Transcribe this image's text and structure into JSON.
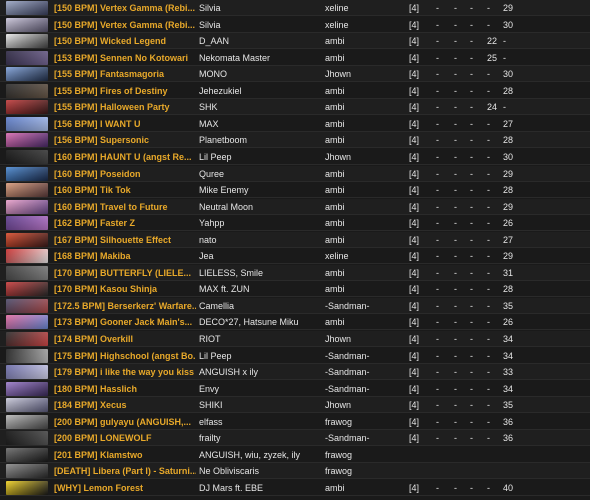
{
  "rows": [
    {
      "title": "[150 BPM] Vertex Gamma (Rebi...",
      "artist": "Silvia",
      "mapper": "xeline",
      "diffs": [
        "[4]",
        "-",
        "-",
        "-",
        "-",
        "29"
      ],
      "thumb_colors": [
        "#9aa6c4",
        "#3a3f5c"
      ]
    },
    {
      "title": "[150 BPM] Vertex Gamma (Rebi...",
      "artist": "Silvia",
      "mapper": "xeline",
      "diffs": [
        "[4]",
        "-",
        "-",
        "-",
        "-",
        "30"
      ],
      "thumb_colors": [
        "#c9c4d8",
        "#5a556e"
      ]
    },
    {
      "title": "[150 BPM] Wicked Legend",
      "artist": "D_AAN",
      "mapper": "ambi",
      "diffs": [
        "[4]",
        "-",
        "-",
        "-",
        "22",
        "-"
      ],
      "thumb_colors": [
        "#e8e8e8",
        "#444444"
      ]
    },
    {
      "title": "[153 BPM] Sennen No Kotowari",
      "artist": "Nekomata Master",
      "mapper": "ambi",
      "diffs": [
        "[4]",
        "-",
        "-",
        "-",
        "25",
        "-"
      ],
      "thumb_colors": [
        "#2b2640",
        "#7a6a9a"
      ]
    },
    {
      "title": "[155 BPM] Fantasmagoria",
      "artist": "MONO",
      "mapper": "Jhown",
      "diffs": [
        "[4]",
        "-",
        "-",
        "-",
        "-",
        "30"
      ],
      "thumb_colors": [
        "#7fa0d8",
        "#22304a"
      ]
    },
    {
      "title": "[155 BPM] Fires of Destiny",
      "artist": "Jehezukiel",
      "mapper": "ambi",
      "diffs": [
        "[4]",
        "-",
        "-",
        "-",
        "-",
        "28"
      ],
      "thumb_colors": [
        "#2a2a2a",
        "#6b5a4a"
      ]
    },
    {
      "title": "[155 BPM] Halloween Party",
      "artist": "SHK",
      "mapper": "ambi",
      "diffs": [
        "[4]",
        "-",
        "-",
        "-",
        "24",
        "-"
      ],
      "thumb_colors": [
        "#c03a3a",
        "#3a1a1a"
      ]
    },
    {
      "title": "[156 BPM] I WANT U",
      "artist": "MAX",
      "mapper": "ambi",
      "diffs": [
        "[4]",
        "-",
        "-",
        "-",
        "-",
        "27"
      ],
      "thumb_colors": [
        "#5a7ac8",
        "#b0c4f0"
      ]
    },
    {
      "title": "[156 BPM] Supersonic",
      "artist": "Planetboom",
      "mapper": "ambi",
      "diffs": [
        "[4]",
        "-",
        "-",
        "-",
        "-",
        "28"
      ],
      "thumb_colors": [
        "#d86ab0",
        "#4a2a6a"
      ]
    },
    {
      "title": "[160 BPM] HAUNT U (angst Re...",
      "artist": "Lil Peep",
      "mapper": "Jhown",
      "diffs": [
        "[4]",
        "-",
        "-",
        "-",
        "-",
        "30"
      ],
      "thumb_colors": [
        "#111111",
        "#444444"
      ]
    },
    {
      "title": "[160 BPM] Poseidon",
      "artist": "Quree",
      "mapper": "ambi",
      "diffs": [
        "[4]",
        "-",
        "-",
        "-",
        "-",
        "29"
      ],
      "thumb_colors": [
        "#4a88d0",
        "#1a2a4a"
      ]
    },
    {
      "title": "[160 BPM] Tik Tok",
      "artist": "Mike Enemy",
      "mapper": "ambi",
      "diffs": [
        "[4]",
        "-",
        "-",
        "-",
        "-",
        "28"
      ],
      "thumb_colors": [
        "#d89a7a",
        "#5a3a3a"
      ]
    },
    {
      "title": "[160 BPM] Travel to Future",
      "artist": "Neutral Moon",
      "mapper": "ambi",
      "diffs": [
        "[4]",
        "-",
        "-",
        "-",
        "-",
        "29"
      ],
      "thumb_colors": [
        "#e8a0c8",
        "#6a4a8a"
      ]
    },
    {
      "title": "[162 BPM] Faster Z",
      "artist": "Yahpp",
      "mapper": "ambi",
      "diffs": [
        "[4]",
        "-",
        "-",
        "-",
        "-",
        "26"
      ],
      "thumb_colors": [
        "#5a3a8a",
        "#c07ad0"
      ]
    },
    {
      "title": "[167 BPM] Silhouette Effect",
      "artist": "nato",
      "mapper": "ambi",
      "diffs": [
        "[4]",
        "-",
        "-",
        "-",
        "-",
        "27"
      ],
      "thumb_colors": [
        "#d84a2a",
        "#3a1a1a"
      ]
    },
    {
      "title": "[168 BPM] Makiba",
      "artist": "Jea",
      "mapper": "xeline",
      "diffs": [
        "[4]",
        "-",
        "-",
        "-",
        "-",
        "29"
      ],
      "thumb_colors": [
        "#c82a2a",
        "#f0f0f0"
      ]
    },
    {
      "title": "[170 BPM] BUTTERFLY (LIELE...",
      "artist": "LIELESS, Smile",
      "mapper": "ambi",
      "diffs": [
        "[4]",
        "-",
        "-",
        "-",
        "-",
        "31"
      ],
      "thumb_colors": [
        "#3a3a3a",
        "#8a8a8a"
      ]
    },
    {
      "title": "[170 BPM] Kasou Shinja",
      "artist": "MAX ft. ZUN",
      "mapper": "ambi",
      "diffs": [
        "[4]",
        "-",
        "-",
        "-",
        "-",
        "28"
      ],
      "thumb_colors": [
        "#c83a3a",
        "#2a2a2a"
      ]
    },
    {
      "title": "[172.5 BPM] Berserkerz' Warfare...",
      "artist": "Camellia",
      "mapper": "-Sandman-",
      "diffs": [
        "[4]",
        "-",
        "-",
        "-",
        "-",
        "35"
      ],
      "thumb_colors": [
        "#4a4a6a",
        "#b04a4a"
      ]
    },
    {
      "title": "[173 BPM] Gooner Jack Main's...",
      "artist": "DECO*27, Hatsune Miku",
      "mapper": "ambi",
      "diffs": [
        "[4]",
        "-",
        "-",
        "-",
        "-",
        "26"
      ],
      "thumb_colors": [
        "#e06aa0",
        "#6a8ad8"
      ]
    },
    {
      "title": "[174 BPM] Overkill",
      "artist": "RIOT",
      "mapper": "Jhown",
      "diffs": [
        "[4]",
        "-",
        "-",
        "-",
        "-",
        "34"
      ],
      "thumb_colors": [
        "#2a2a2a",
        "#d84a4a"
      ]
    },
    {
      "title": "[175 BPM] Highschool (angst Bo...",
      "artist": "Lil Peep",
      "mapper": "-Sandman-",
      "diffs": [
        "[4]",
        "-",
        "-",
        "-",
        "-",
        "34"
      ],
      "thumb_colors": [
        "#1a1a1a",
        "#c8c8c8"
      ]
    },
    {
      "title": "[179 BPM] i like the way you kiss ...",
      "artist": "ANGUISH x ily",
      "mapper": "-Sandman-",
      "diffs": [
        "[4]",
        "-",
        "-",
        "-",
        "-",
        "33"
      ],
      "thumb_colors": [
        "#6a6aa8",
        "#d8d8f0"
      ]
    },
    {
      "title": "[180 BPM] Hasslich",
      "artist": "Envy",
      "mapper": "-Sandman-",
      "diffs": [
        "[4]",
        "-",
        "-",
        "-",
        "-",
        "34"
      ],
      "thumb_colors": [
        "#9a7ac8",
        "#3a2a5a"
      ]
    },
    {
      "title": "[184 BPM] Xecus",
      "artist": "SHIKI",
      "mapper": "Jhown",
      "diffs": [
        "[4]",
        "-",
        "-",
        "-",
        "-",
        "35"
      ],
      "thumb_colors": [
        "#c8c8d8",
        "#5a5a7a"
      ]
    },
    {
      "title": "[200 BPM] gulyayu (ANGUISH,...",
      "artist": "elfass",
      "mapper": "frawog",
      "diffs": [
        "[4]",
        "-",
        "-",
        "-",
        "-",
        "36"
      ],
      "thumb_colors": [
        "#b8b8b8",
        "#4a4a4a"
      ]
    },
    {
      "title": "[200 BPM] LONEWOLF",
      "artist": "frailty",
      "mapper": "-Sandman-",
      "diffs": [
        "[4]",
        "-",
        "-",
        "-",
        "-",
        "36"
      ],
      "thumb_colors": [
        "#0e0e0e",
        "#5a5a5a"
      ]
    },
    {
      "title": "[201 BPM] Klamstwo",
      "artist": "ANGUISH, wiu, zyzek, ily",
      "mapper": "frawog",
      "diffs": [
        "",
        "",
        "",
        "",
        "",
        ""
      ],
      "thumb_colors": [
        "#6a6a6a",
        "#1a1a1a"
      ]
    },
    {
      "title": "[DEATH] Libera (Part I) - Saturni...",
      "artist": "Ne Obliviscaris",
      "mapper": "frawog",
      "diffs": [
        "",
        "",
        "",
        "",
        "",
        ""
      ],
      "thumb_colors": [
        "#8a8a8a",
        "#2a2a2a"
      ]
    },
    {
      "title": "[WHY] Lemon Forest",
      "artist": "DJ Mars ft. EBE",
      "mapper": "ambi",
      "diffs": [
        "[4]",
        "-",
        "-",
        "-",
        "-",
        "40"
      ],
      "thumb_colors": [
        "#f0d020",
        "#1a1a1a"
      ]
    }
  ]
}
